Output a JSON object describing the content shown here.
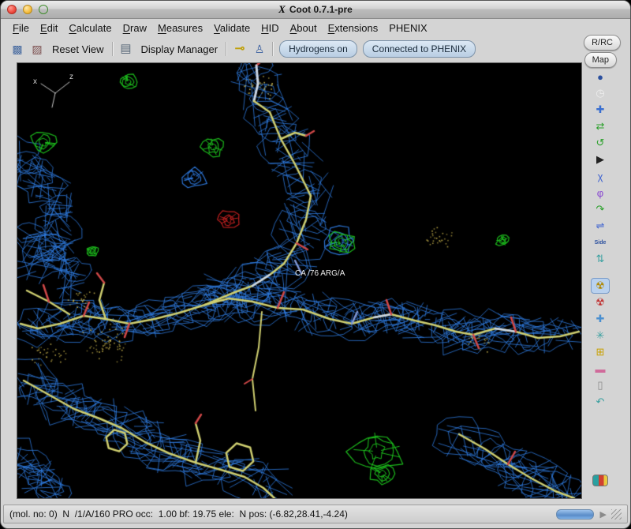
{
  "window": {
    "title": "Coot 0.7.1-pre",
    "icon_glyph": "X"
  },
  "menubar": {
    "items": [
      {
        "label": "File",
        "mnemonic": 0
      },
      {
        "label": "Edit",
        "mnemonic": 0
      },
      {
        "label": "Calculate",
        "mnemonic": 0
      },
      {
        "label": "Draw",
        "mnemonic": 0
      },
      {
        "label": "Measures",
        "mnemonic": 0
      },
      {
        "label": "Validate",
        "mnemonic": 0
      },
      {
        "label": "HID",
        "mnemonic": 0
      },
      {
        "label": "About",
        "mnemonic": 0
      },
      {
        "label": "Extensions",
        "mnemonic": 0
      },
      {
        "label": "PHENIX",
        "mnemonic": -1
      }
    ]
  },
  "side_buttons": {
    "rrc": "R/RC",
    "map": "Map"
  },
  "toolbar": {
    "open_coords_icon": "▩",
    "open_map_icon": "▨",
    "reset_view": "Reset View",
    "display_manager_icon": "▤",
    "display_manager": "Display Manager",
    "key_icon": "⊸",
    "figure_icon": "♙",
    "hydrogens": "Hydrogens on",
    "phenix": "Connected to PHENIX"
  },
  "viewport": {
    "atom_label": "CA /76 ARG/A",
    "axis_labels": [
      "x",
      "z"
    ],
    "colors": {
      "background": "#000000",
      "density_map": "#2e7adf",
      "difference_positive": "#1ec41e",
      "difference_negative": "#cc2222",
      "carbon_bond": "#cfcf70",
      "light_bond": "#ccd6e4",
      "oxygen_tick": "#d04848",
      "nitrogen_tick": "#8098d8",
      "water_dots": "#c9b44c"
    }
  },
  "rightbar": {
    "icons": [
      {
        "name": "blue-sphere-icon",
        "glyph": "●",
        "color": "#2a4f9e"
      },
      {
        "name": "clock-icon",
        "glyph": "◷",
        "color": "#ededed"
      },
      {
        "name": "move-arrows-icon",
        "glyph": "✚",
        "color": "#3a6fd0"
      },
      {
        "name": "exchange-arrows-icon",
        "glyph": "⇄",
        "color": "#2aa02a"
      },
      {
        "name": "rotate-ccw-icon",
        "glyph": "↺",
        "color": "#2aa02a"
      },
      {
        "name": "play-icon",
        "glyph": "▶",
        "color": "#222222"
      },
      {
        "name": "chi-angles-icon",
        "glyph": "χ",
        "color": "#3a5fd0"
      },
      {
        "name": "phi-torsion-icon",
        "glyph": "φ",
        "color": "#8a4ad0"
      },
      {
        "name": "flip-arrow-icon",
        "glyph": "↷",
        "color": "#2aa02a"
      },
      {
        "name": "equilibrium-arrows-icon",
        "glyph": "⇌",
        "color": "#3a5fd0"
      },
      {
        "name": "side-chain-180-icon",
        "glyph": "Side",
        "color": "#2a4f9e"
      },
      {
        "name": "up-down-arrows-icon",
        "glyph": "⇅",
        "color": "#3aa0a0"
      },
      {
        "name": "radiation-yellow-icon",
        "glyph": "☢",
        "color": "#b08800",
        "selected": true,
        "gap_before": true
      },
      {
        "name": "radiation-red-icon",
        "glyph": "☢",
        "color": "#c03030"
      },
      {
        "name": "plus-cross-icon",
        "glyph": "✚",
        "color": "#4a8fd0"
      },
      {
        "name": "asterisk-tool-icon",
        "glyph": "✳",
        "color": "#3aa0a0"
      },
      {
        "name": "squared-plus-icon",
        "glyph": "⊞",
        "color": "#c8a000"
      },
      {
        "name": "eraser-icon",
        "glyph": "▬",
        "color": "#d06a9a"
      },
      {
        "name": "trash-icon",
        "glyph": "▯",
        "color": "#8a8a8a"
      },
      {
        "name": "undo-arrow-icon",
        "glyph": "↶",
        "color": "#3aa0a0"
      },
      {
        "name": "picture-icon",
        "glyph": "",
        "color": "#ffffff",
        "picture": true
      }
    ]
  },
  "statusbar": {
    "text": "(mol. no: 0)  N  /1/A/160 PRO occ:  1.00 bf: 19.75 ele:  N pos: (-6.82,28.41,-4.24)",
    "arrow_glyph": "▶"
  }
}
